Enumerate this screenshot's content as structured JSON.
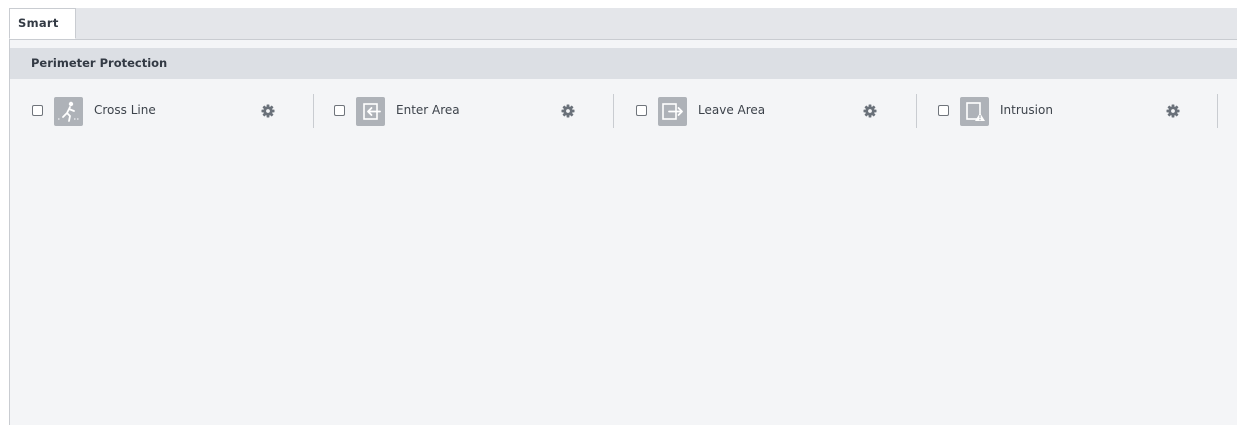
{
  "tabs": [
    {
      "label": "Smart"
    }
  ],
  "section": {
    "title": "Perimeter Protection"
  },
  "features": [
    {
      "label": "Cross Line",
      "icon": "cross-line-icon",
      "checked": false
    },
    {
      "label": "Enter Area",
      "icon": "enter-area-icon",
      "checked": false
    },
    {
      "label": "Leave Area",
      "icon": "leave-area-icon",
      "checked": false
    },
    {
      "label": "Intrusion",
      "icon": "intrusion-icon",
      "checked": false
    }
  ],
  "colors": {
    "icon_bg": "#aeb2b8",
    "gear": "#6a717a",
    "panel_bg": "#f4f5f7",
    "header_bg": "#dcdfe4"
  }
}
